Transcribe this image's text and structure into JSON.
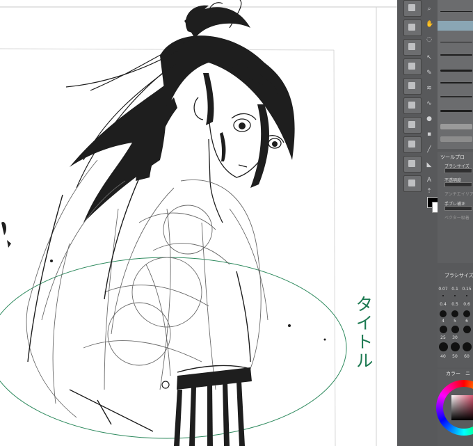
{
  "canvas": {
    "handwritten_title": "タイトル"
  },
  "tool_property": {
    "title": "ツールプロ",
    "brush_size_label": "ブラシサイズ",
    "opacity_label": "不透明度",
    "antialias_label": "アンチエイリアス",
    "stabilization_label": "手ブレ補正",
    "vector_label": "ベクター吸着"
  },
  "brush_size_panel": {
    "title": "ブラシサイズ",
    "sizes": [
      "0.07",
      "0.1",
      "0.15",
      "0.4",
      "0.5",
      "0.6",
      "4",
      "5",
      "6",
      "25",
      "30",
      "40",
      "50",
      "60"
    ]
  },
  "color_panel": {
    "title": "カラー",
    "short_label": "ニ"
  },
  "colors": {
    "panel_bg": "#58595b",
    "ink": "#1e1e1e",
    "guide_ellipse": "#2e8a5e",
    "handwriting": "#1d7a52"
  }
}
